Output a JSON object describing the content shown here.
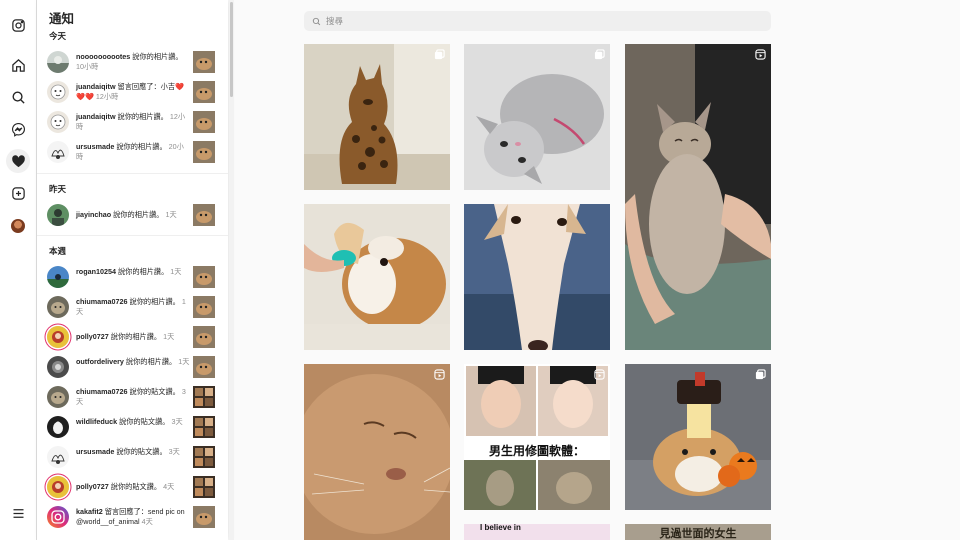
{
  "rail": {
    "items": [
      {
        "name": "instagram-icon"
      },
      {
        "name": "home-icon"
      },
      {
        "name": "search-icon"
      },
      {
        "name": "messenger-icon"
      },
      {
        "name": "heart-icon"
      },
      {
        "name": "create-icon"
      },
      {
        "name": "profile-avatar"
      },
      {
        "name": "menu-icon"
      }
    ]
  },
  "panel": {
    "title": "通知",
    "sections": {
      "today": "今天",
      "yesterday": "昨天",
      "this_week": "本週"
    },
    "today": [
      {
        "user": "noooooooootes",
        "action": " 說你的相片讚。",
        "time": "10小時"
      },
      {
        "user": "juandaiqitw",
        "action": " 留言回應了：小吉❤️❤️❤️",
        "time": "12小時"
      },
      {
        "user": "juandaiqitw",
        "action": " 說你的相片讚。",
        "time": "12小時"
      },
      {
        "user": "ursusmade",
        "action": " 說你的相片讚。",
        "time": "20小時"
      }
    ],
    "yesterday": [
      {
        "user": "jiayinchao",
        "action": " 說你的相片讚。",
        "time": "1天"
      }
    ],
    "this_week": [
      {
        "user": "rogan10254",
        "action": " 說你的相片讚。",
        "time": "1天"
      },
      {
        "user": "chiumama0726",
        "action": " 說你的相片讚。",
        "time": "1天"
      },
      {
        "user": "polly0727",
        "action": " 說你的相片讚。",
        "time": "1天"
      },
      {
        "user": "outfordelivery",
        "action": " 說你的相片讚。",
        "time": "1天"
      },
      {
        "user": "chiumama0726",
        "action": " 說你的貼文讚。",
        "time": "3天"
      },
      {
        "user": "wildlifeduck",
        "action": " 說你的貼文讚。",
        "time": "3天"
      },
      {
        "user": "ursusmade",
        "action": " 說你的貼文讚。",
        "time": "3天"
      },
      {
        "user": "polly0727",
        "action": " 說你的貼文讚。",
        "time": "4天"
      },
      {
        "user": "kakafit2",
        "action": " 留言回應了：send pic on @world__of_animal",
        "time": "4天"
      }
    ]
  },
  "search": {
    "placeholder": "搜尋",
    "value": ""
  },
  "grid": {
    "captions": {
      "meme_caption": "男生用修圖軟體：",
      "tile_i_believe": "I believe in",
      "tile_bottom_right": "見過世面的女生"
    },
    "badges": {
      "tile1": "multi-icon",
      "tile2": "multi-icon",
      "tile3": "reels-icon",
      "tile7": "reels-icon",
      "tile9": "multi-icon"
    }
  },
  "colors": {
    "accent_ring": "#e1306c",
    "panel_bg": "#ffffff",
    "page_bg": "#fafafa",
    "search_bg": "#efefef"
  }
}
